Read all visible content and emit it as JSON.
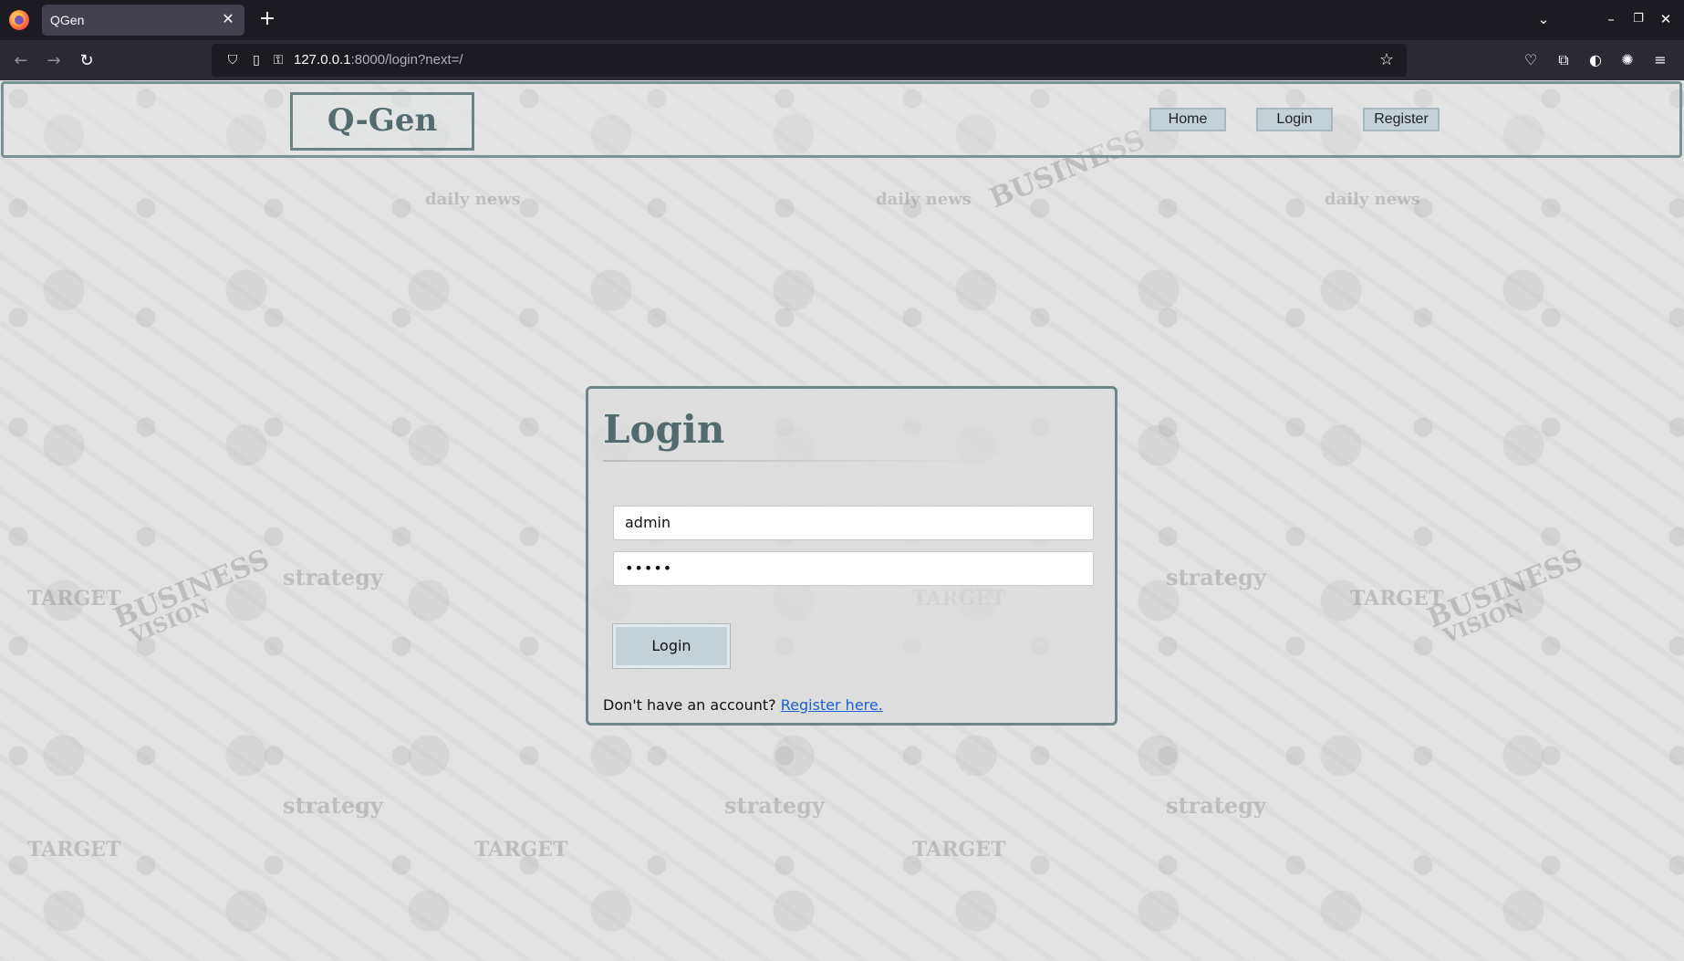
{
  "browser": {
    "tab_title": "QGen",
    "url_host": "127.0.0.1",
    "url_rest": ":8000/login?next=/"
  },
  "header": {
    "brand": "Q-Gen",
    "nav": [
      {
        "label": "Home"
      },
      {
        "label": "Login"
      },
      {
        "label": "Register"
      }
    ]
  },
  "login": {
    "title": "Login",
    "username_value": "admin",
    "password_value": "•••••",
    "button_label": "Login",
    "register_prompt": "Don't have an account?",
    "register_link": "Register here."
  },
  "background_words": [
    "daily news",
    "BUSINESS",
    "VISION",
    "strategy",
    "TARGET"
  ],
  "colors": {
    "accent": "#536b6f",
    "button_bg": "#c4d1d6",
    "link": "#1a5fd6"
  }
}
